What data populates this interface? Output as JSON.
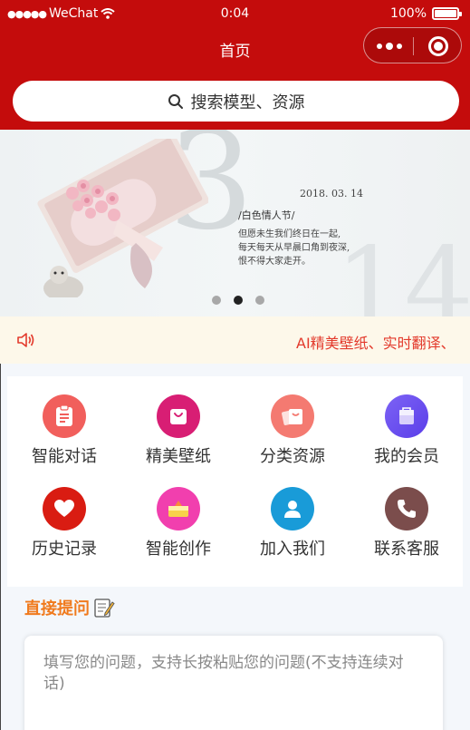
{
  "status_bar": {
    "carrier": "WeChat",
    "time": "0:04",
    "battery": "100%"
  },
  "nav": {
    "title": "首页"
  },
  "search": {
    "placeholder": "搜索模型、资源",
    "icon": "search-icon"
  },
  "banner": {
    "date": "2018. 03. 14",
    "title": "/白色情人节/",
    "lines": [
      "但愿未生我们终日在一起,",
      "每天每天从早晨口角到夜深,",
      "恨不得大家走开。"
    ],
    "big_numbers": [
      "3",
      "14"
    ],
    "slide_count": 3,
    "active_slide": 2
  },
  "notice": {
    "icon": "speaker-icon",
    "text": "AI精美壁纸、实时翻译、"
  },
  "grid": {
    "items": [
      {
        "label": "智能对话",
        "icon": "clipboard-icon",
        "color": "#f15f5c"
      },
      {
        "label": "精美壁纸",
        "icon": "shopping-bag-icon",
        "color": "#d81e74"
      },
      {
        "label": "分类资源",
        "icon": "gift-bag-icon",
        "color": "#f47a71"
      },
      {
        "label": "我的会员",
        "icon": "member-bag-icon",
        "color": "#6a4ff1"
      },
      {
        "label": "历史记录",
        "icon": "heart-icon",
        "color": "#d91c12"
      },
      {
        "label": "智能创作",
        "icon": "cake-icon",
        "color": "#f13fae"
      },
      {
        "label": "加入我们",
        "icon": "person-icon",
        "color": "#199bd8"
      },
      {
        "label": "联系客服",
        "icon": "phone-icon",
        "color": "#7b4d4c"
      }
    ]
  },
  "question": {
    "title": "直接提问",
    "title_icon": "memo-icon",
    "placeholder": "填写您的问题，支持长按粘贴您的问题(不支持连续对话)"
  }
}
